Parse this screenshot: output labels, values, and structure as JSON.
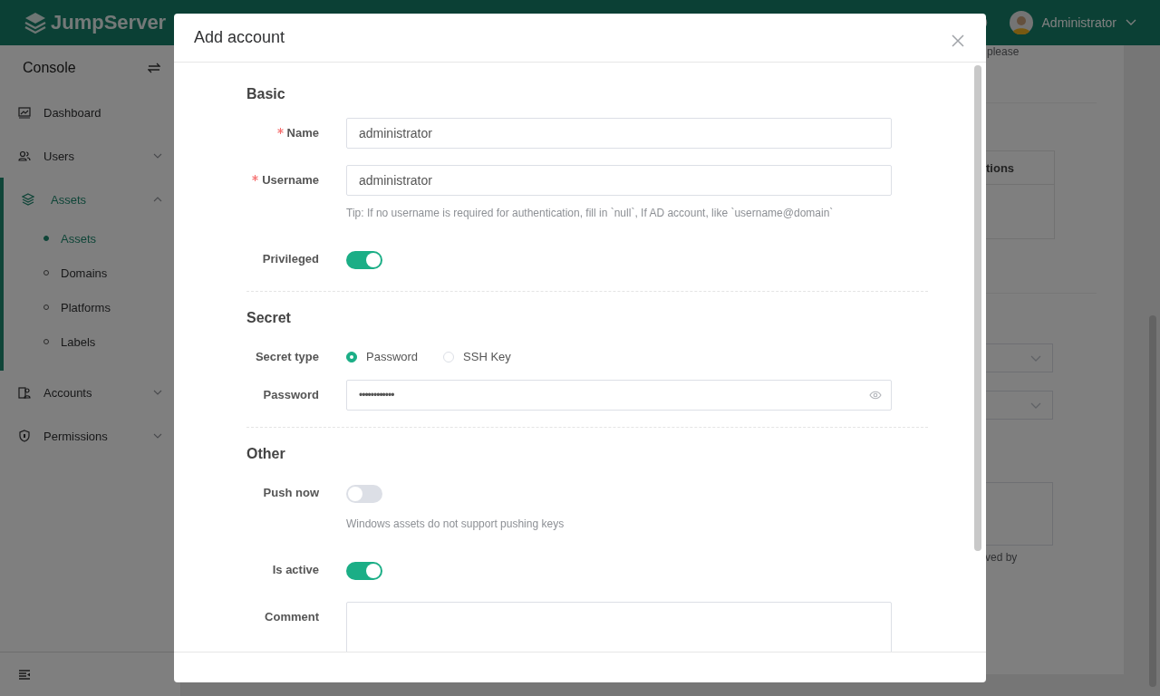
{
  "header": {
    "logo": "JumpServer",
    "user": "Administrator"
  },
  "sidebar": {
    "title": "Console",
    "items": [
      {
        "label": "Dashboard",
        "selected": false
      },
      {
        "label": "Users",
        "selected": false,
        "expanded": false
      },
      {
        "label": "Assets",
        "selected": true,
        "expanded": true,
        "children": [
          {
            "label": "Assets",
            "selected": true
          },
          {
            "label": "Domains",
            "selected": false
          },
          {
            "label": "Platforms",
            "selected": false
          },
          {
            "label": "Labels",
            "selected": false
          }
        ]
      },
      {
        "label": "Accounts",
        "selected": false,
        "expanded": false
      },
      {
        "label": "Permissions",
        "selected": false,
        "expanded": false
      }
    ]
  },
  "background": {
    "note": "please",
    "table_header": "tions",
    "textarea_note": "ved by"
  },
  "dialog": {
    "title": "Add account",
    "sections": [
      {
        "title": "Basic",
        "fields": [
          {
            "kind": "input",
            "label": "Name",
            "required": true,
            "value": "administrator"
          },
          {
            "kind": "input",
            "label": "Username",
            "required": true,
            "value": "administrator",
            "tip": "Tip: If no username is required for authentication, fill in `null`, If AD account, like `username@domain`"
          },
          {
            "kind": "switch",
            "label": "Privileged",
            "on": true
          }
        ]
      },
      {
        "title": "Secret",
        "fields": [
          {
            "kind": "radio",
            "label": "Secret type",
            "options": [
              {
                "label": "Password",
                "selected": true
              },
              {
                "label": "SSH Key",
                "selected": false
              }
            ]
          },
          {
            "kind": "password",
            "label": "Password",
            "value": "••••••••••••"
          }
        ]
      },
      {
        "title": "Other",
        "fields": [
          {
            "kind": "switch",
            "label": "Push now",
            "on": false,
            "tip": "Windows assets do not support pushing keys"
          },
          {
            "kind": "switch",
            "label": "Is active",
            "on": true
          },
          {
            "kind": "textarea",
            "label": "Comment"
          }
        ]
      }
    ]
  }
}
